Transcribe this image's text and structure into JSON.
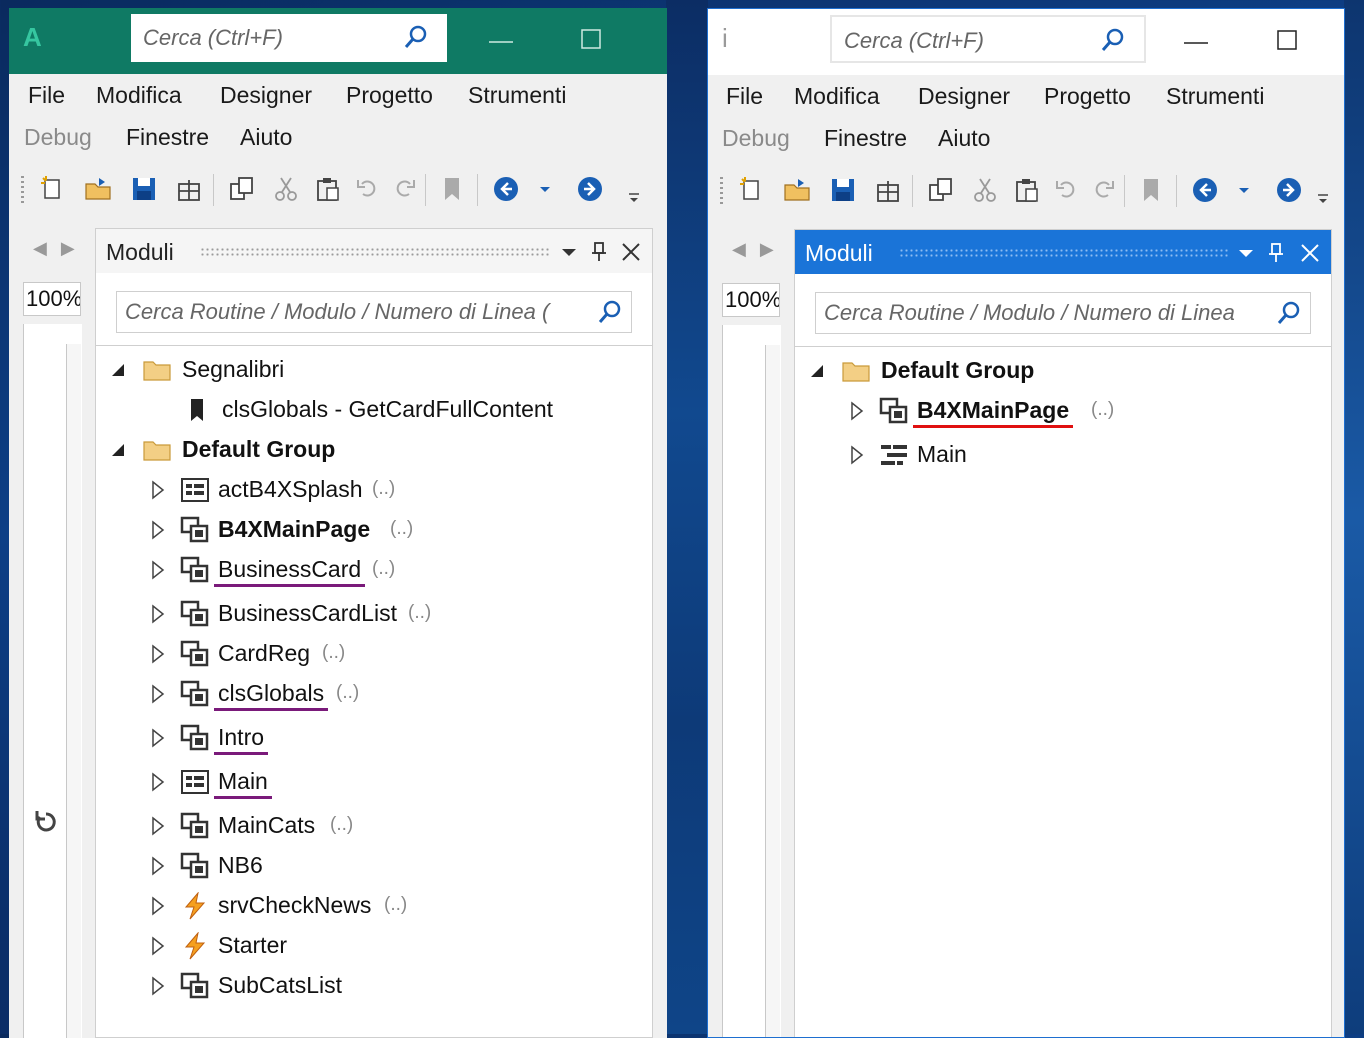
{
  "windows": [
    {
      "id": "left",
      "app_logo": "A",
      "search_placeholder": "Cerca (Ctrl+F)",
      "menu_row1": [
        "File",
        "Modifica",
        "Designer",
        "Progetto",
        "Strumenti"
      ],
      "menu_row2": [
        "Debug",
        "Finestre",
        "Aiuto"
      ],
      "zoom": "100%",
      "panel": {
        "title": "Moduli",
        "search_placeholder": "Cerca Routine / Modulo / Numero di Linea (",
        "groups": [
          {
            "label": "Segnalibri",
            "items": [
              {
                "label": "clsGlobals - GetCardFullContent",
                "icon": "bookmark-icon",
                "count": ""
              }
            ]
          },
          {
            "label": "Default Group",
            "items": [
              {
                "label": "actB4XSplash",
                "icon": "activity-module-icon",
                "count": "(..)"
              },
              {
                "label": "B4XMainPage",
                "icon": "class-module-icon",
                "count": "(..)"
              },
              {
                "label": "BusinessCard",
                "icon": "class-module-icon",
                "count": "(..)"
              },
              {
                "label": "BusinessCardList",
                "icon": "class-module-icon",
                "count": "(..)"
              },
              {
                "label": "CardReg",
                "icon": "class-module-icon",
                "count": "(..)"
              },
              {
                "label": "clsGlobals",
                "icon": "class-module-icon",
                "count": "(..)"
              },
              {
                "label": "Intro",
                "icon": "class-module-icon",
                "count": ""
              },
              {
                "label": "Main",
                "icon": "activity-module-icon",
                "count": ""
              },
              {
                "label": "MainCats",
                "icon": "class-module-icon",
                "count": "(..)"
              },
              {
                "label": "NB6",
                "icon": "class-module-icon",
                "count": ""
              },
              {
                "label": "srvCheckNews",
                "icon": "service-module-icon",
                "count": "(..)"
              },
              {
                "label": "Starter",
                "icon": "service-module-icon",
                "count": ""
              },
              {
                "label": "SubCatsList",
                "icon": "class-module-icon",
                "count": ""
              }
            ]
          }
        ]
      }
    },
    {
      "id": "right",
      "app_logo": "i",
      "search_placeholder": "Cerca (Ctrl+F)",
      "menu_row1": [
        "File",
        "Modifica",
        "Designer",
        "Progetto",
        "Strumenti"
      ],
      "menu_row2": [
        "Debug",
        "Finestre",
        "Aiuto"
      ],
      "zoom": "100%",
      "panel": {
        "title": "Moduli",
        "search_placeholder": "Cerca Routine / Modulo / Numero di Linea",
        "groups": [
          {
            "label": "Default Group",
            "items": [
              {
                "label": "B4XMainPage",
                "icon": "class-module-icon",
                "count": "(..)"
              },
              {
                "label": "Main",
                "icon": "main-module-icon",
                "count": ""
              }
            ]
          }
        ]
      }
    }
  ],
  "colors": {
    "left_titlebar": "#0f7a64",
    "right_panel_header": "#1a74d8",
    "underline_purple": "#7a1a7a",
    "underline_red": "#e01010",
    "toolbar_blue": "#1a5fb4"
  }
}
